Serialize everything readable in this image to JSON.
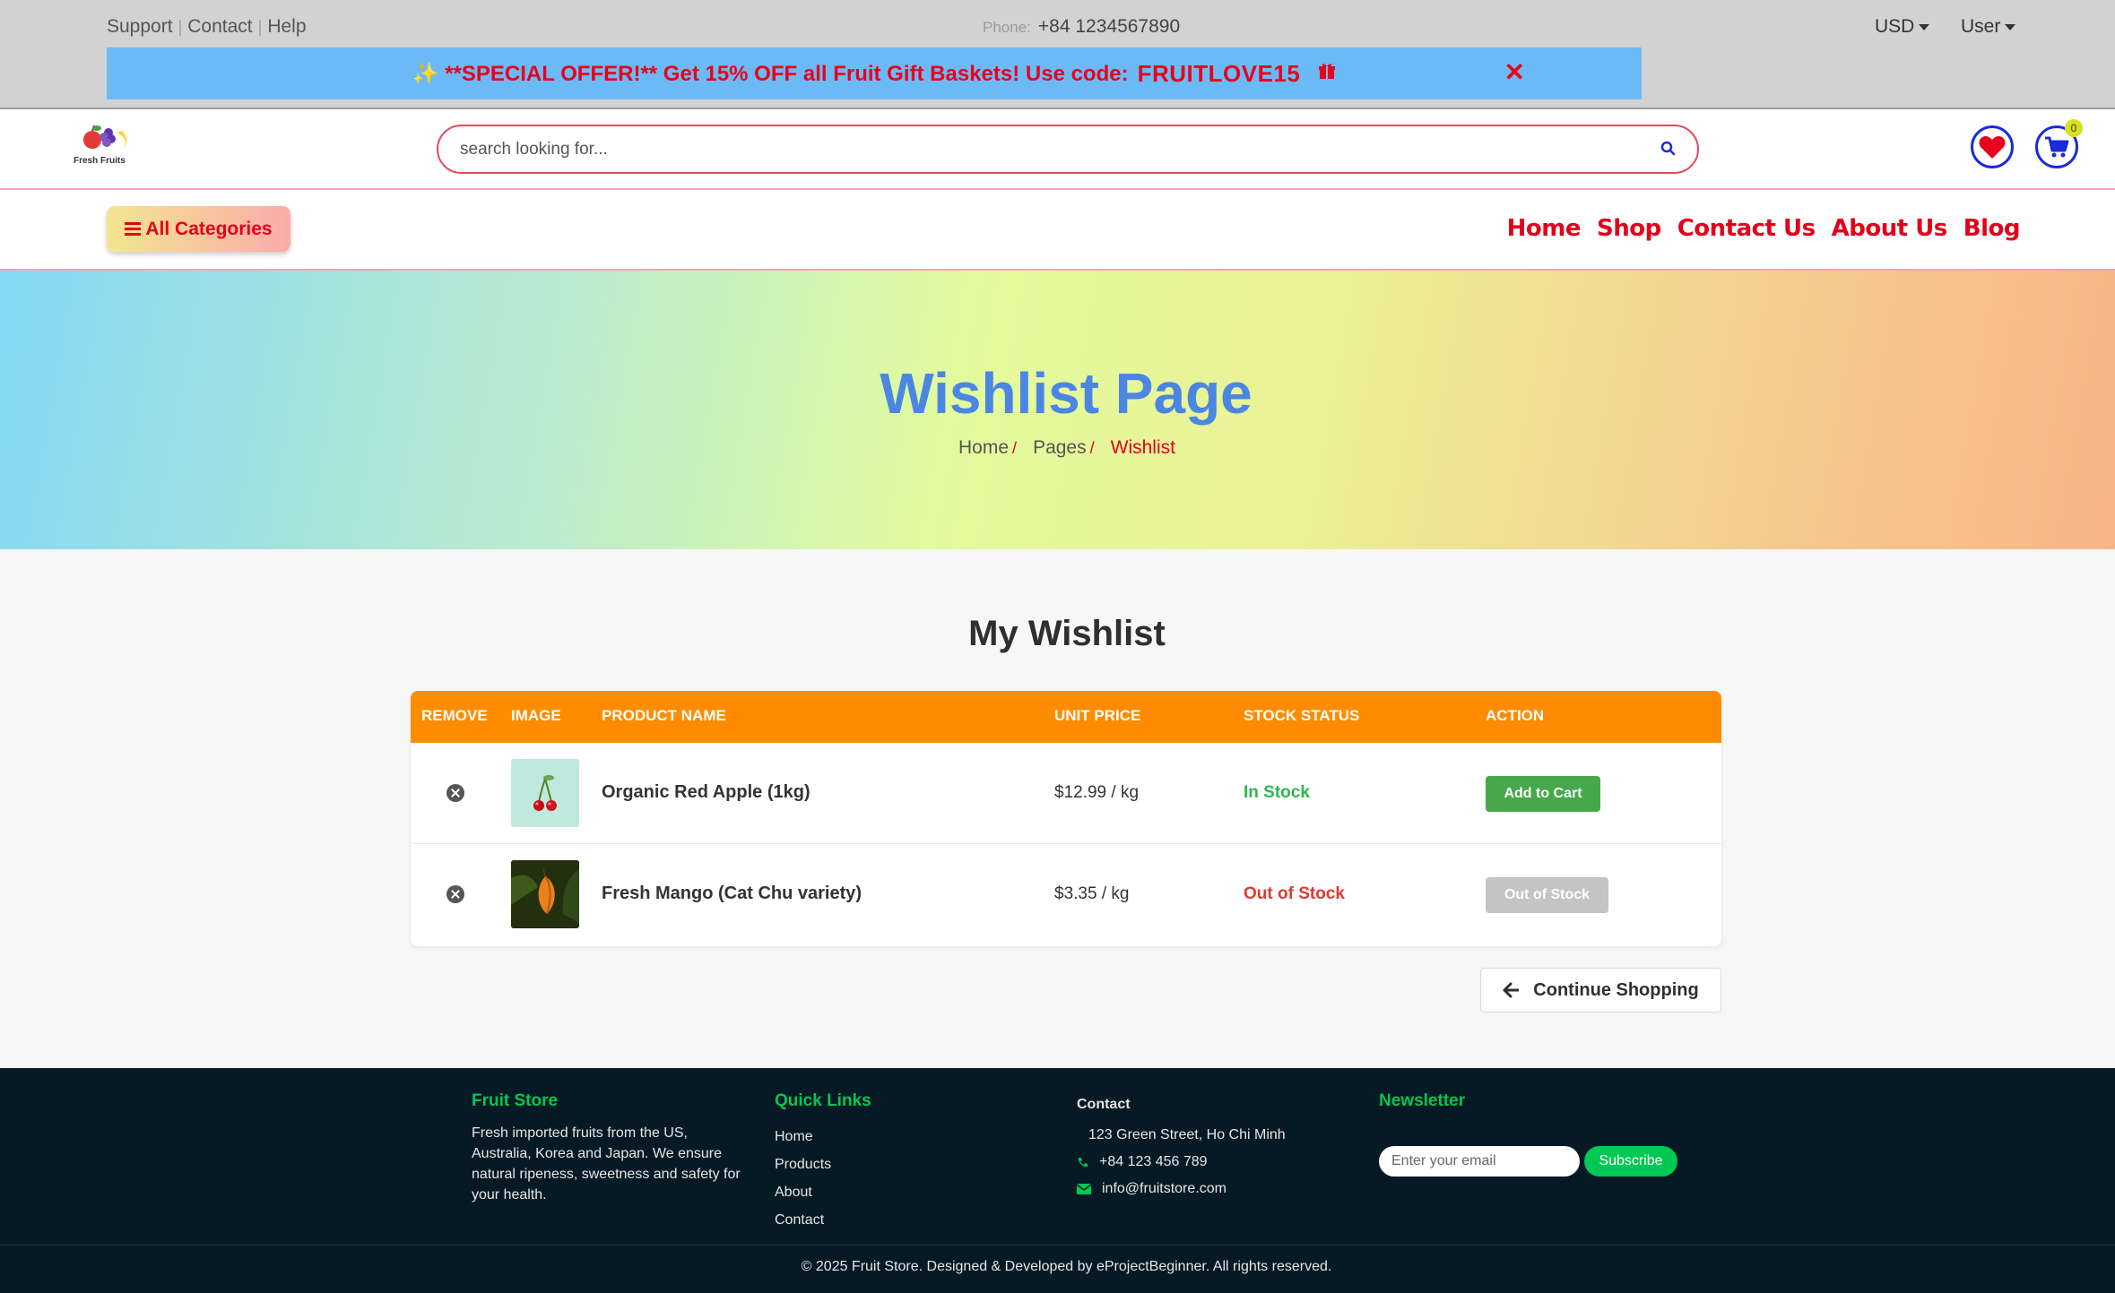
{
  "topbar": {
    "links": [
      "Support",
      "Contact",
      "Help"
    ],
    "phone_label": "Phone:",
    "phone": "+84 1234567890",
    "currency": "USD",
    "user": "User"
  },
  "offer": {
    "text": "✨ **SPECIAL OFFER!** Get 15% OFF all Fruit Gift Baskets! Use code:",
    "code": "FRUITLOVE15",
    "gift_icon": "gift-icon",
    "close_icon": "close-icon"
  },
  "header": {
    "logo_text": "Fresh Fruits",
    "search_placeholder": "search looking for...",
    "cart_count": "0"
  },
  "nav": {
    "categories_label": "All Categories",
    "menu": [
      "Home",
      "Shop",
      "Contact Us",
      "About Us",
      "Blog"
    ]
  },
  "hero": {
    "title": "Wishlist Page",
    "breadcrumb": [
      "Home",
      "Pages",
      "Wishlist"
    ]
  },
  "wishlist": {
    "title": "My Wishlist",
    "columns": [
      "REMOVE",
      "IMAGE",
      "PRODUCT NAME",
      "UNIT PRICE",
      "STOCK STATUS",
      "ACTION"
    ],
    "items": [
      {
        "name": "Organic Red Apple (1kg)",
        "price": "$12.99 / kg",
        "stock": "In Stock",
        "stock_color": "#2db84b",
        "action": "Add to Cart"
      },
      {
        "name": "Fresh Mango (Cat Chu variety)",
        "price": "$3.35 / kg",
        "stock": "Out of Stock",
        "stock_color": "#e03a2f",
        "action": "Out of Stock"
      }
    ],
    "continue_label": "Continue Shopping"
  },
  "footer": {
    "about_title": "Fruit Store",
    "about_text": "Fresh imported fruits from the US, Australia, Korea and Japan. We ensure natural ripeness, sweetness and safety for your health.",
    "links_title": "Quick Links",
    "links": [
      "Home",
      "Products",
      "About",
      "Contact"
    ],
    "contact_title": "Contact",
    "address": "123 Green Street, Ho Chi Minh",
    "phone": "+84 123 456 789",
    "email": "info@fruitstore.com",
    "newsletter_title": "Newsletter",
    "newsletter_placeholder": "Enter your email",
    "subscribe_label": "Subscribe",
    "copyright": "© 2025 Fruit Store. Designed & Developed by eProjectBeginner. All rights reserved."
  },
  "colors": {
    "accent_red": "#e3001b",
    "table_header": "#ff8c00",
    "footer_bg": "#051a24",
    "footer_green": "#00c853",
    "hero_title": "#4b86e3"
  }
}
